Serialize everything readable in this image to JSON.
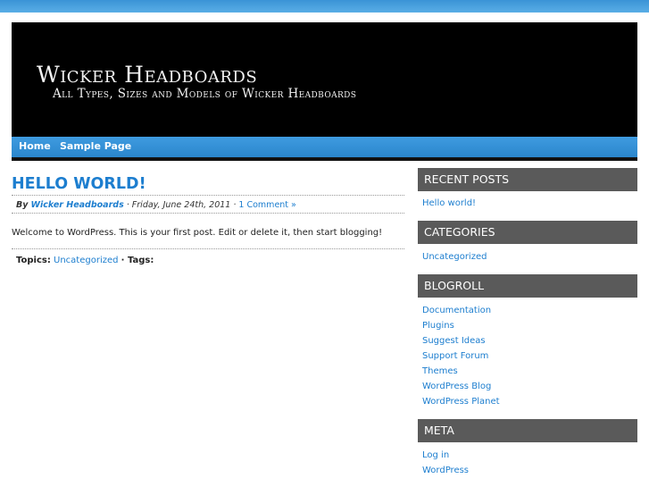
{
  "header": {
    "title": "Wicker Headboards",
    "description": "All Types, Sizes and Models of Wicker Headboards"
  },
  "nav": {
    "items": [
      {
        "label": "Home"
      },
      {
        "label": "Sample Page"
      }
    ]
  },
  "post": {
    "title": "HELLO WORLD!",
    "by_label": "By",
    "author": "Wicker Headboards",
    "date": "· Friday, June 24th, 2011 ·",
    "comments": "1 Comment »",
    "content": "Welcome to WordPress. This is your first post. Edit or delete it, then start blogging!",
    "topics_label": "Topics:",
    "topics": "Uncategorized",
    "tags_label": "· Tags:"
  },
  "sidebar": {
    "recent_posts": {
      "title": "RECENT POSTS",
      "items": [
        "Hello world!"
      ]
    },
    "categories": {
      "title": "CATEGORIES",
      "items": [
        "Uncategorized"
      ]
    },
    "blogroll": {
      "title": "BLOGROLL",
      "items": [
        "Documentation",
        "Plugins",
        "Suggest Ideas",
        "Support Forum",
        "Themes",
        "WordPress Blog",
        "WordPress Planet"
      ]
    },
    "meta": {
      "title": "META",
      "items": [
        "Log in",
        "WordPress"
      ]
    }
  },
  "colors": {
    "accent": "#1d7ecf",
    "nav": "#2f8fd8",
    "widget_header": "#5a5a5a",
    "header_bg": "#000000"
  }
}
